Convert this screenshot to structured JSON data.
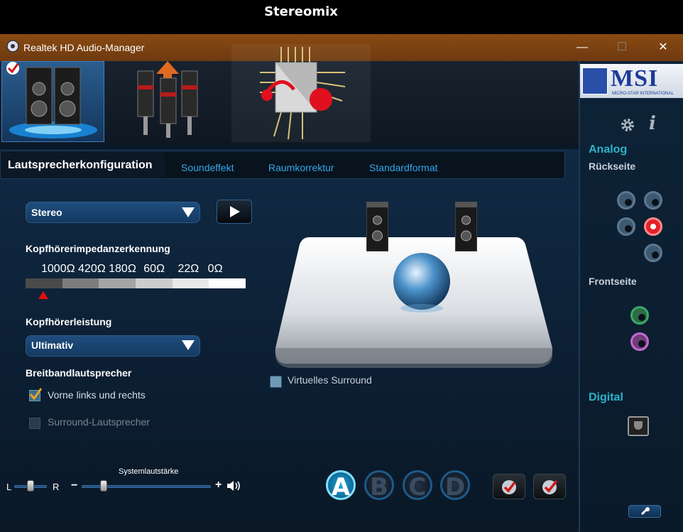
{
  "caption": "Stereomix",
  "window": {
    "title": "Realtek HD Audio-Manager",
    "minimize_label": "—",
    "maximize_label": "☐",
    "close_label": "✕"
  },
  "tabs": [
    {
      "label": "Lautsprecherkonfiguration",
      "active": true
    },
    {
      "label": "Soundeffekt"
    },
    {
      "label": "Raumkorrektur"
    },
    {
      "label": "Standardformat"
    }
  ],
  "speaker_config": {
    "selected": "Stereo",
    "impedance_title": "Kopfhörerimpedanzerkennung",
    "impedance_values": [
      "1000Ω",
      "420Ω",
      "180Ω",
      "60Ω",
      "22Ω",
      "0Ω"
    ],
    "impedance_level_fraction": 0.08,
    "power_title": "Kopfhörerleistung",
    "power_selected": "Ultimativ",
    "fullrange_title": "Breitbandlautsprecher",
    "front_lr_label": "Vorne links und rechts",
    "front_lr_checked": true,
    "surround_label": "Surround-Lautsprecher",
    "surround_checked": false,
    "virtual_surround_label": "Virtuelles Surround",
    "virtual_surround_checked": false
  },
  "volume": {
    "title": "Systemlautstärke",
    "balance_left": "L",
    "balance_right": "R",
    "minus": "−",
    "plus": "+",
    "balance_fraction": 0.5,
    "level_fraction": 0.17
  },
  "profiles": [
    "A",
    "B",
    "C",
    "D"
  ],
  "active_profile": "A",
  "right_panel": {
    "brand": "MSI",
    "brand_sub": "MICRO-STAR INTERNATIONAL",
    "analog_title": "Analog",
    "rear_title": "Rückseite",
    "front_title": "Frontseite",
    "digital_title": "Digital",
    "info_icon": "i"
  },
  "colors": {
    "accent": "#36a6e8",
    "section_head": "#2bb3c9",
    "titlebar": "#7a4212",
    "active_jack": "#e3202a",
    "front_green": "#3aa86a",
    "front_pink": "#c06ad0"
  }
}
